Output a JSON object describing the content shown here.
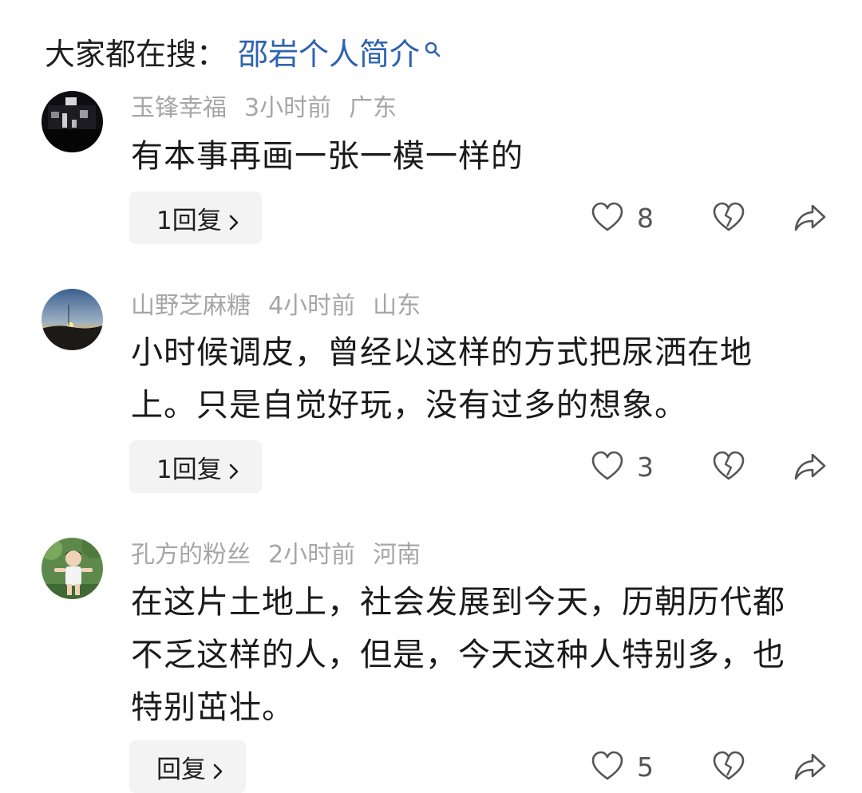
{
  "search": {
    "prefix": "大家都在搜：",
    "query": "邵岩个人简介",
    "icon": "search-icon",
    "link_color": "#2f63b0"
  },
  "comments": [
    {
      "username": "玉锋幸福",
      "time": "3小时前",
      "location": "广东",
      "text": "有本事再画一张一模一样的",
      "reply_label": "1回复",
      "likes": "8"
    },
    {
      "username": "山野芝麻糖",
      "time": "4小时前",
      "location": "山东",
      "text": "小时候调皮，曾经以这样的方式把尿洒在地上。只是自觉好玩，没有过多的想象。",
      "reply_label": "1回复",
      "likes": "3"
    },
    {
      "username": "孔方的粉丝",
      "time": "2小时前",
      "location": "河南",
      "text": "在这片土地上，社会发展到今天，历朝历代都不乏这样的人，但是，今天这种人特别多，也特别茁壮。",
      "reply_label": "回复",
      "likes": "5"
    }
  ],
  "colors": {
    "meta_text": "#a6a6a6",
    "reply_bg": "#f3f3f3",
    "icon_stroke": "#555555"
  }
}
